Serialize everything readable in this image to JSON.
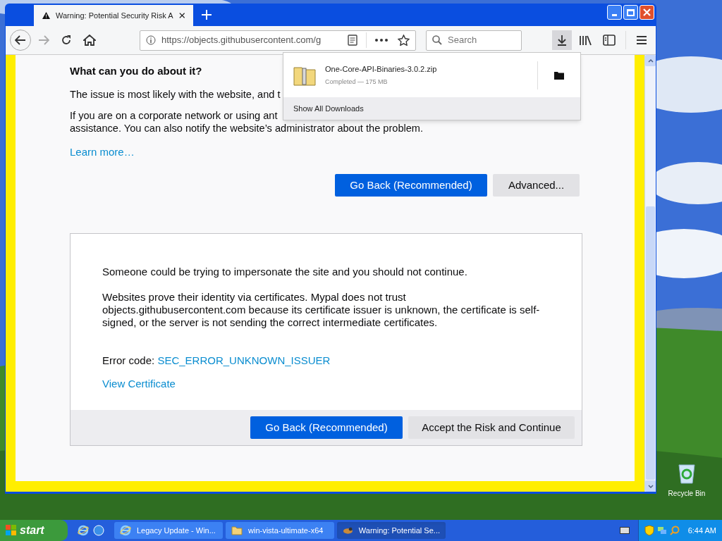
{
  "window": {
    "tab": {
      "title": "Warning: Potential Security Risk A",
      "selected": true
    },
    "url": "https://objects.githubusercontent.com/g",
    "search": {
      "placeholder": "Search"
    },
    "downloads_open": true
  },
  "downloads_panel": {
    "items": [
      {
        "name": "One-Core-API-Binaries-3.0.2.zip",
        "status": "Completed — 175 MB"
      }
    ],
    "footer": "Show All Downloads"
  },
  "page": {
    "heading": "What can you do about it?",
    "paragraphs": [
      [
        "The issue is most likely with the website, and t"
      ],
      [
        "If you are on a corporate network or using ant",
        "assistance. You can also notify the website’s administrator about the problem."
      ]
    ],
    "link": "Learn more…",
    "buttons": [
      {
        "label": "Go Back (Recommended)",
        "kind": "primary"
      },
      {
        "label": "Advanced...",
        "kind": "secondary"
      }
    ],
    "advanced": {
      "paragraphs": [
        "Someone could be trying to impersonate the site and you should not continue.",
        "Websites prove their identity via certificates. Mypal does not trust objects.githubusercontent.com because its certificate issuer is unknown, the certificate is self-signed, or the server is not sending the correct intermediate certificates."
      ],
      "error_label": "Error code:",
      "error_code": "SEC_ERROR_UNKNOWN_ISSUER",
      "link": "View Certificate",
      "buttons": [
        {
          "label": "Go Back (Recommended)",
          "kind": "primary"
        },
        {
          "label": "Accept the Risk and Continue",
          "kind": "secondary"
        }
      ]
    }
  },
  "desktop": {
    "icons": [
      {
        "label": "Recycle Bin"
      }
    ]
  },
  "taskbar": {
    "start": "start",
    "items": [
      {
        "label": "Legacy Update - Win...",
        "kind": "ie",
        "selected": false
      },
      {
        "label": "win-vista-ultimate-x64",
        "kind": "folder",
        "selected": false
      },
      {
        "label": "Warning: Potential Se...",
        "kind": "browser",
        "selected": true
      }
    ],
    "clock": "6:44 AM"
  }
}
